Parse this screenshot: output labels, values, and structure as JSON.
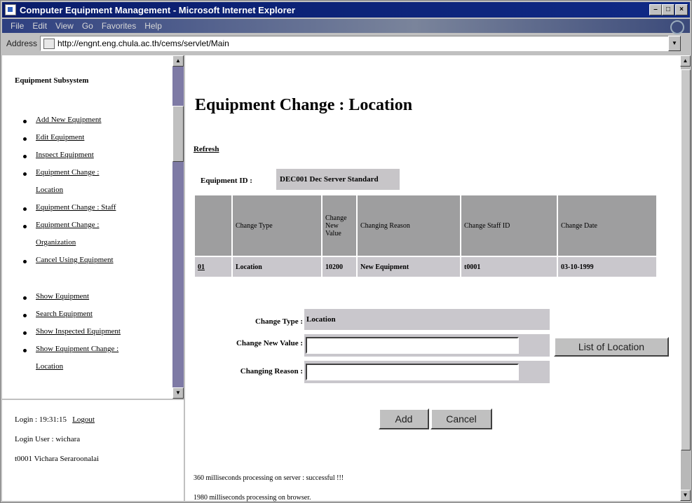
{
  "window": {
    "title": "Computer Equipment Management - Microsoft Internet Explorer"
  },
  "menu": [
    "File",
    "Edit",
    "View",
    "Go",
    "Favorites",
    "Help"
  ],
  "address": {
    "label": "Address",
    "url": "http://engnt.eng.chula.ac.th/cems/servlet/Main"
  },
  "sidebar": {
    "title": "Equipment Subsystem",
    "items": [
      "Add New Equipment",
      "Edit Equipment",
      "Inspect Equipment",
      "Equipment Change :",
      "Location",
      "Equipment Change : Staff",
      "Equipment Change :",
      "Organization",
      "Cancel Using Equipment",
      "Show Equipment",
      "Search Equipment",
      "Show Inspected Equipment",
      "Show Equipment Change :",
      "Location"
    ]
  },
  "login": {
    "time_label": "Login : 19:31:15",
    "logout": "Logout",
    "user_label": "Login User : wichara",
    "staff": "t0001    Vichara Seraroonalai"
  },
  "main": {
    "title": "Equipment Change : Location",
    "refresh": "Refresh",
    "equipment_id_label": "Equipment ID :",
    "equipment_id_value": "DEC001 Dec Server Standard",
    "table": {
      "headers": [
        "",
        "Change Type",
        "Change New Value",
        "Changing Reason",
        "Change Staff ID",
        "Change Date"
      ],
      "rows": [
        [
          "01",
          "Location",
          "10200",
          "New Equipment",
          "t0001",
          "03-10-1999"
        ]
      ]
    },
    "form": {
      "change_type_label": "Change Type :",
      "change_type_value": "Location",
      "new_value_label": "Change New Value :",
      "new_value": "",
      "reason_label": "Changing Reason :",
      "reason": "",
      "list_button": "List of Location",
      "add_button": "Add",
      "cancel_button": "Cancel"
    },
    "status": [
      "360 milliseconds processing on server : successful !!!",
      "1980 milliseconds processing on browser."
    ]
  }
}
